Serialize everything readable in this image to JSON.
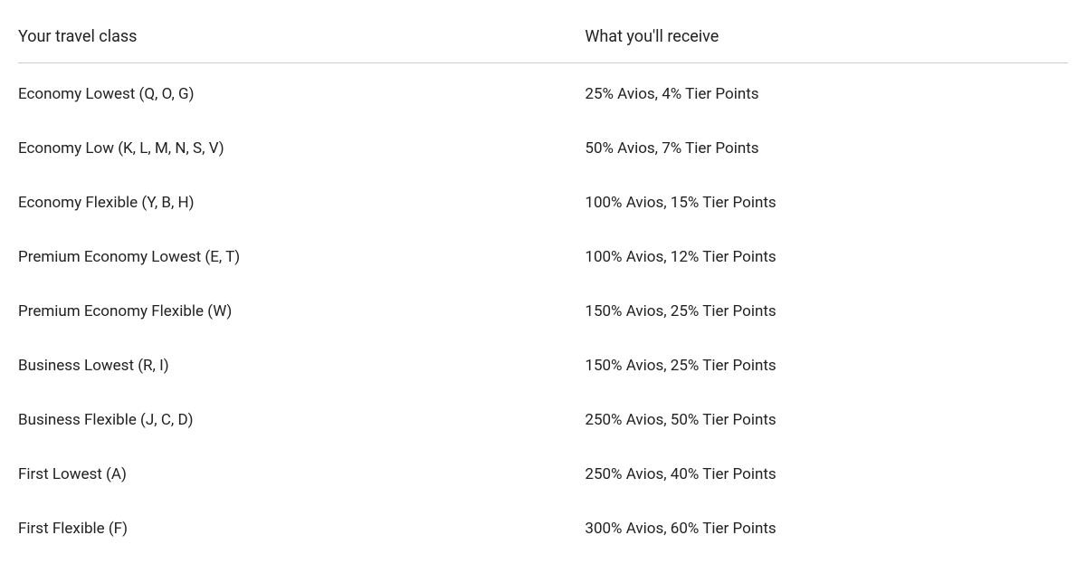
{
  "table": {
    "headers": {
      "travel_class": "Your travel class",
      "receive": "What you'll receive"
    },
    "rows": [
      {
        "travel_class": "Economy Lowest (Q, O, G)",
        "receive": "25% Avios, 4% Tier Points"
      },
      {
        "travel_class": "Economy Low (K, L, M, N, S, V)",
        "receive": "50% Avios, 7% Tier Points"
      },
      {
        "travel_class": "Economy Flexible (Y, B, H)",
        "receive": "100% Avios, 15% Tier Points"
      },
      {
        "travel_class": "Premium Economy Lowest (E, T)",
        "receive": "100% Avios, 12% Tier Points"
      },
      {
        "travel_class": "Premium Economy Flexible (W)",
        "receive": "150% Avios, 25% Tier Points"
      },
      {
        "travel_class": "Business Lowest (R, I)",
        "receive": "150% Avios, 25% Tier Points"
      },
      {
        "travel_class": "Business Flexible (J, C, D)",
        "receive": "250% Avios, 50% Tier Points"
      },
      {
        "travel_class": "First Lowest (A)",
        "receive": "250% Avios, 40% Tier Points"
      },
      {
        "travel_class": "First Flexible (F)",
        "receive": "300% Avios, 60% Tier Points"
      }
    ]
  }
}
